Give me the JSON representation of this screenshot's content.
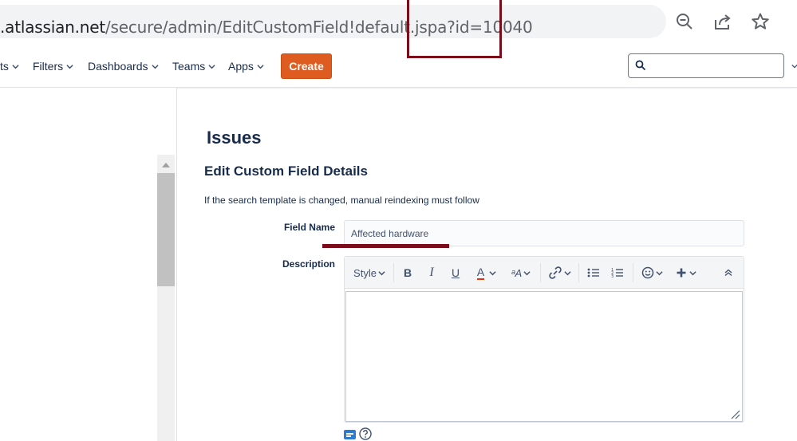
{
  "browser": {
    "url_host": ".atlassian.net",
    "url_path": "/secure/admin/EditCustomField!default.jspa?id=10040",
    "icons": [
      "zoom-out-icon",
      "share-icon",
      "star-icon"
    ]
  },
  "nav": {
    "items": [
      {
        "label": "ts"
      },
      {
        "label": "Filters"
      },
      {
        "label": "Dashboards"
      },
      {
        "label": "Teams"
      },
      {
        "label": "Apps"
      }
    ],
    "create_label": "Create",
    "search_placeholder": "",
    "create_color": "#de5c1f"
  },
  "main": {
    "page_title": "Issues",
    "section_title": "Edit Custom Field Details",
    "hint": "If the search template is changed, manual reindexing must follow",
    "field_name_label": "Field Name",
    "field_name_value": "Affected hardware",
    "description_label": "Description",
    "editor": {
      "style_label": "Style",
      "bold": "B",
      "italic": "I",
      "underline": "U",
      "text_color": "A",
      "format": "ᵃA"
    }
  },
  "colors": {
    "annotation": "#7d0c1b"
  }
}
